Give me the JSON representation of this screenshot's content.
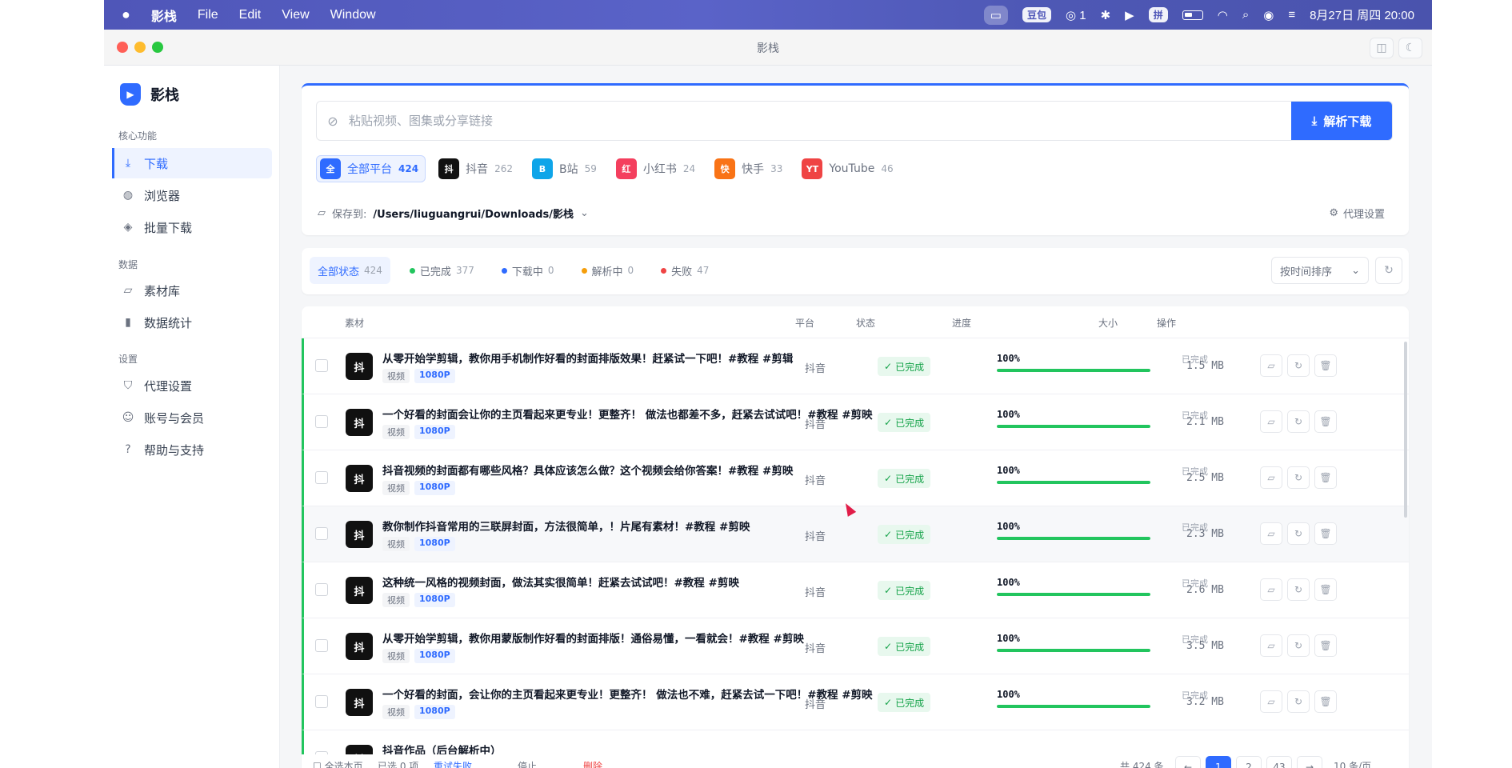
{
  "menubar": {
    "app_name": "影栈",
    "menus": [
      "File",
      "Edit",
      "View",
      "Window"
    ],
    "status": {
      "tag1": "豆包",
      "wechat_count": "1",
      "ime": "拼",
      "datetime": "8月27日 周四  20:00"
    }
  },
  "window": {
    "title": "影栈"
  },
  "sidebar": {
    "brand": "影栈",
    "sections": [
      {
        "label": "核心功能",
        "items": [
          "下载",
          "浏览器",
          "批量下载"
        ]
      },
      {
        "label": "数据",
        "items": [
          "素材库",
          "数据统计"
        ]
      },
      {
        "label": "设置",
        "items": [
          "代理设置",
          "账号与会员",
          "帮助与支持"
        ]
      }
    ]
  },
  "downloader": {
    "url_placeholder": "粘贴视频、图集或分享链接",
    "parse_button": "解析下载",
    "platforms": [
      {
        "badge": "全",
        "name": "全部平台",
        "count": "424",
        "color": "#2f6bff"
      },
      {
        "badge": "抖",
        "name": "抖音",
        "count": "262",
        "color": "#111111"
      },
      {
        "badge": "B",
        "name": "B站",
        "count": "59",
        "color": "#0ea5e9"
      },
      {
        "badge": "红",
        "name": "小红书",
        "count": "24",
        "color": "#f43f5e"
      },
      {
        "badge": "快",
        "name": "快手",
        "count": "33",
        "color": "#f97316"
      },
      {
        "badge": "YT",
        "name": "YouTube",
        "count": "46",
        "color": "#ef4444"
      }
    ],
    "save_label": "保存到:",
    "save_path": "/Users/liuguangrui/Downloads/影栈",
    "proxy_link": "代理设置"
  },
  "filters": {
    "tabs": [
      {
        "label": "全部状态",
        "count": "424",
        "color": ""
      },
      {
        "label": "已完成",
        "count": "377",
        "color": "#22c55e"
      },
      {
        "label": "下载中",
        "count": "0",
        "color": "#2f6bff"
      },
      {
        "label": "解析中",
        "count": "0",
        "color": "#f59e0b"
      },
      {
        "label": "失败",
        "count": "47",
        "color": "#ef4444"
      }
    ],
    "sort": "按时间排序"
  },
  "table": {
    "headers": {
      "material": "素材",
      "platform": "平台",
      "status": "状态",
      "progress": "进度",
      "size": "大小",
      "ops": "操作"
    },
    "rows": [
      {
        "title": "从零开始学剪辑，教你用手机制作好看的封面排版效果！赶紧试一下吧！#教程 #剪辑",
        "kind": "视频",
        "res": "1080P",
        "platform": "抖音",
        "status": "已完成",
        "pct": "100%",
        "progress": 1.0,
        "prog_label": "已完成",
        "size": "1.5 MB"
      },
      {
        "title": "一个好看的封面会让你的主页看起来更专业！更整齐！ 做法也都差不多，赶紧去试试吧！#教程 #剪映",
        "kind": "视频",
        "res": "1080P",
        "platform": "抖音",
        "status": "已完成",
        "pct": "100%",
        "progress": 1.0,
        "prog_label": "已完成",
        "size": "2.1 MB"
      },
      {
        "title": "抖音视频的封面都有哪些风格？具体应该怎么做？这个视频会给你答案！#教程 #剪映",
        "kind": "视频",
        "res": "1080P",
        "platform": "抖音",
        "status": "已完成",
        "pct": "100%",
        "progress": 1.0,
        "prog_label": "已完成",
        "size": "2.5 MB"
      },
      {
        "title": "教你制作抖音常用的三联屏封面，方法很简单，！片尾有素材！#教程 #剪映",
        "kind": "视频",
        "res": "1080P",
        "platform": "抖音",
        "status": "已完成",
        "pct": "100%",
        "progress": 1.0,
        "prog_label": "已完成",
        "size": "2.3 MB"
      },
      {
        "title": "这种统一风格的视频封面，做法其实很简单！赶紧去试试吧！#教程 #剪映",
        "kind": "视频",
        "res": "1080P",
        "platform": "抖音",
        "status": "已完成",
        "pct": "100%",
        "progress": 1.0,
        "prog_label": "已完成",
        "size": "2.6 MB"
      },
      {
        "title": "从零开始学剪辑，教你用蒙版制作好看的封面排版！通俗易懂，一看就会！#教程 #剪映",
        "kind": "视频",
        "res": "1080P",
        "platform": "抖音",
        "status": "已完成",
        "pct": "100%",
        "progress": 1.0,
        "prog_label": "已完成",
        "size": "3.5 MB"
      },
      {
        "title": "一个好看的封面，会让你的主页看起来更专业！更整齐！ 做法也不难，赶紧去试一下吧！#教程 #剪映",
        "kind": "视频",
        "res": "1080P",
        "platform": "抖音",
        "status": "已完成",
        "pct": "100%",
        "progress": 1.0,
        "prog_label": "已完成",
        "size": "3.2 MB"
      },
      {
        "title": "抖音作品（后台解析中）",
        "kind": "",
        "res": "",
        "platform": "",
        "status": "",
        "pct": "",
        "progress": 0,
        "prog_label": "",
        "size": ""
      }
    ]
  },
  "footer": {
    "select_page": "全选本页",
    "selected": "已选 0 项",
    "retry": "重试失败",
    "stop": "停止",
    "delete": "删除",
    "total": "共 424 条",
    "pages": [
      "1",
      "2",
      "43"
    ],
    "per_page": "10 条/页"
  }
}
